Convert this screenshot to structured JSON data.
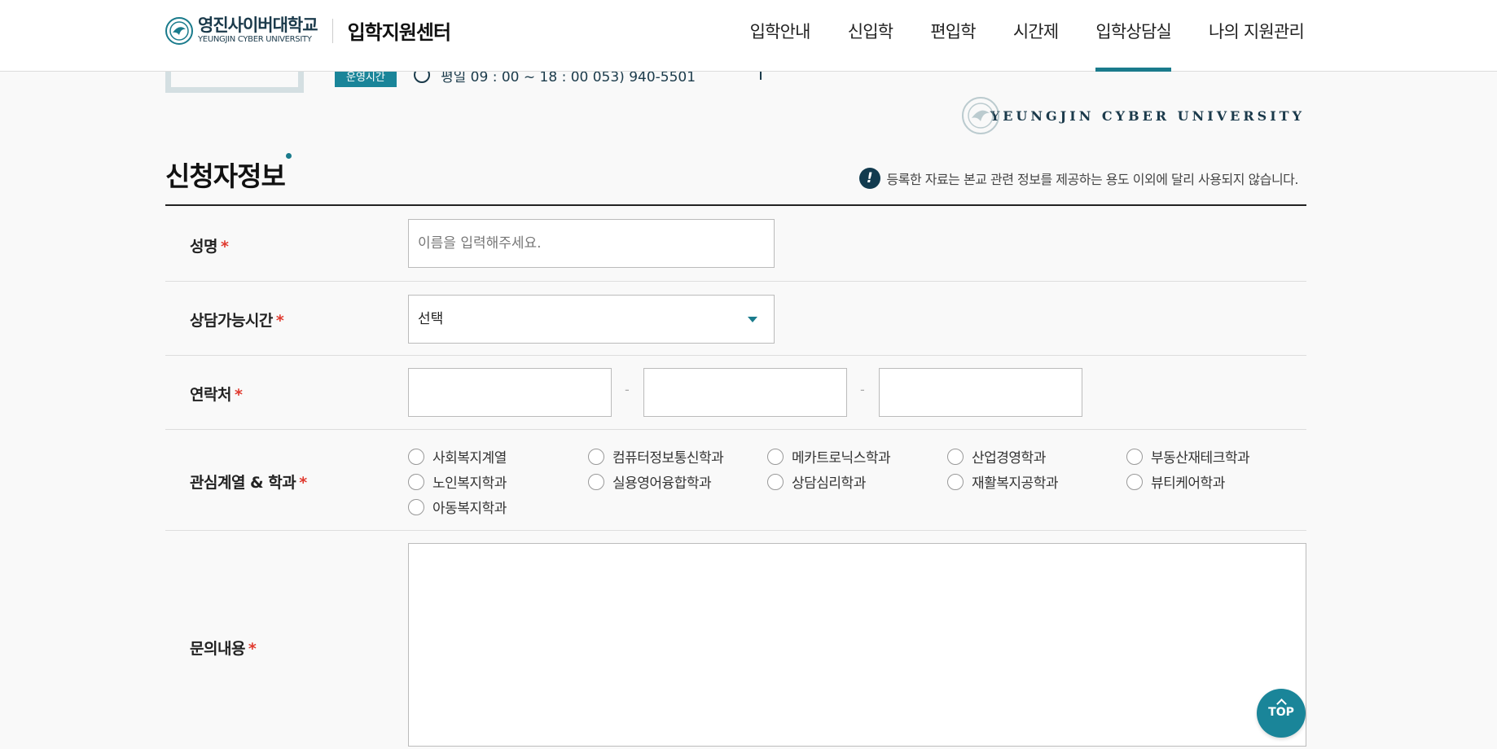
{
  "header": {
    "logo_ko": "영진사이버대학교",
    "logo_en": "YEUNGJIN CYBER UNIVERSITY",
    "center_title": "입학지원센터",
    "nav": [
      {
        "label": "입학안내"
      },
      {
        "label": "신입학"
      },
      {
        "label": "편입학"
      },
      {
        "label": "시간제"
      },
      {
        "label": "입학상담실",
        "active": true
      },
      {
        "label": "나의 지원관리"
      }
    ]
  },
  "strip": {
    "badge": "운영시간",
    "info": "평일 09 : 00 ~ 18 : 00  053) 940-5501"
  },
  "brand": {
    "text": "YEUNGJIN CYBER UNIVERSITY"
  },
  "section": {
    "title": "신청자정보",
    "notice_icon": "!",
    "notice": "등록한 자료는 본교 관련 정보를 제공하는 용도 이외에 달리 사용되지 않습니다."
  },
  "form": {
    "required_mark": "*",
    "name": {
      "label": "성명",
      "placeholder": "이름을 입력해주세요."
    },
    "time": {
      "label": "상담가능시간",
      "selected": "선택"
    },
    "tel": {
      "label": "연락처",
      "separator": "-"
    },
    "major": {
      "label": "관심계열 & 학과",
      "options": [
        "사회복지계열",
        "컴퓨터정보통신학과",
        "메카트로닉스학과",
        "산업경영학과",
        "부동산재테크학과",
        "노인복지학과",
        "실용영어융합학과",
        "상담심리학과",
        "재활복지공학과",
        "뷰티케어학과",
        "아동복지학과"
      ]
    },
    "message": {
      "label": "문의내용"
    }
  },
  "top_button": {
    "label": "TOP"
  },
  "colors": {
    "accent": "#1a7b8c",
    "required": "#e03a2f",
    "dark": "#123b4f"
  }
}
